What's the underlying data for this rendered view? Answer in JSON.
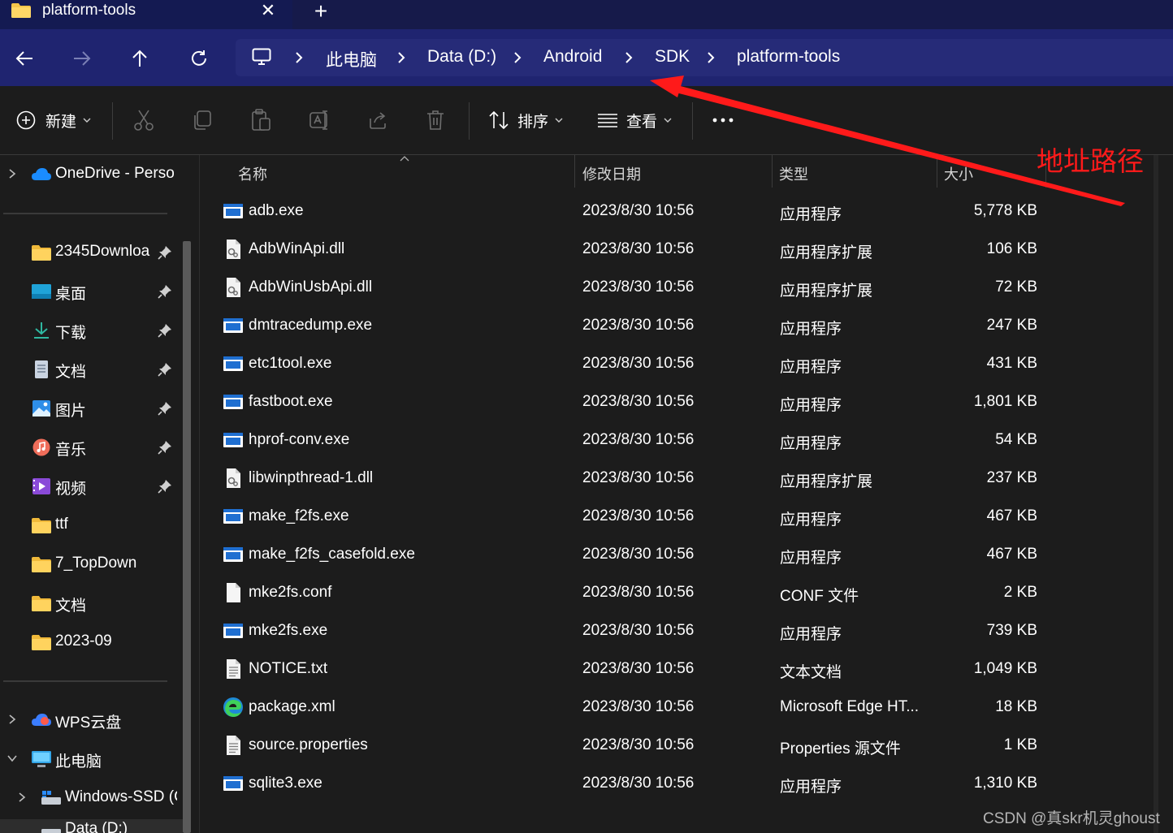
{
  "window": {
    "tab_title": "platform-tools",
    "close_symbol": "✕",
    "new_tab_symbol": "+"
  },
  "nav": {
    "breadcrumbs": [
      "此电脑",
      "Data (D:)",
      "Android",
      "SDK",
      "platform-tools"
    ]
  },
  "toolbar": {
    "new_label": "新建",
    "sort_label": "排序",
    "view_label": "查看"
  },
  "sidebar": {
    "onedrive": "OneDrive - Perso",
    "pinned": [
      {
        "label": "2345Downloa",
        "icon": "folder-icon"
      },
      {
        "label": "桌面",
        "icon": "desktop-icon"
      },
      {
        "label": "下载",
        "icon": "download-icon"
      },
      {
        "label": "文档",
        "icon": "documents-icon"
      },
      {
        "label": "图片",
        "icon": "pictures-icon"
      },
      {
        "label": "音乐",
        "icon": "music-icon"
      },
      {
        "label": "视频",
        "icon": "videos-icon"
      }
    ],
    "folders": [
      "ttf",
      "7_TopDown",
      "文档",
      "2023-09"
    ],
    "wps": "WPS云盘",
    "this_pc": "此电脑",
    "windows_ssd": "Windows-SSD (C",
    "data_drive": "Data (D:)"
  },
  "columns": {
    "name": "名称",
    "date": "修改日期",
    "type": "类型",
    "size": "大小"
  },
  "files": [
    {
      "name": "adb.exe",
      "date": "2023/8/30 10:56",
      "type": "应用程序",
      "size": "5,778 KB",
      "icon": "exe"
    },
    {
      "name": "AdbWinApi.dll",
      "date": "2023/8/30 10:56",
      "type": "应用程序扩展",
      "size": "106 KB",
      "icon": "dll"
    },
    {
      "name": "AdbWinUsbApi.dll",
      "date": "2023/8/30 10:56",
      "type": "应用程序扩展",
      "size": "72 KB",
      "icon": "dll"
    },
    {
      "name": "dmtracedump.exe",
      "date": "2023/8/30 10:56",
      "type": "应用程序",
      "size": "247 KB",
      "icon": "exe"
    },
    {
      "name": "etc1tool.exe",
      "date": "2023/8/30 10:56",
      "type": "应用程序",
      "size": "431 KB",
      "icon": "exe"
    },
    {
      "name": "fastboot.exe",
      "date": "2023/8/30 10:56",
      "type": "应用程序",
      "size": "1,801 KB",
      "icon": "exe"
    },
    {
      "name": "hprof-conv.exe",
      "date": "2023/8/30 10:56",
      "type": "应用程序",
      "size": "54 KB",
      "icon": "exe"
    },
    {
      "name": "libwinpthread-1.dll",
      "date": "2023/8/30 10:56",
      "type": "应用程序扩展",
      "size": "237 KB",
      "icon": "dll"
    },
    {
      "name": "make_f2fs.exe",
      "date": "2023/8/30 10:56",
      "type": "应用程序",
      "size": "467 KB",
      "icon": "exe"
    },
    {
      "name": "make_f2fs_casefold.exe",
      "date": "2023/8/30 10:56",
      "type": "应用程序",
      "size": "467 KB",
      "icon": "exe"
    },
    {
      "name": "mke2fs.conf",
      "date": "2023/8/30 10:56",
      "type": "CONF 文件",
      "size": "2 KB",
      "icon": "blank"
    },
    {
      "name": "mke2fs.exe",
      "date": "2023/8/30 10:56",
      "type": "应用程序",
      "size": "739 KB",
      "icon": "exe"
    },
    {
      "name": "NOTICE.txt",
      "date": "2023/8/30 10:56",
      "type": "文本文档",
      "size": "1,049 KB",
      "icon": "txt"
    },
    {
      "name": "package.xml",
      "date": "2023/8/30 10:56",
      "type": "Microsoft Edge HT...",
      "size": "18 KB",
      "icon": "edge"
    },
    {
      "name": "source.properties",
      "date": "2023/8/30 10:56",
      "type": "Properties 源文件",
      "size": "1 KB",
      "icon": "txt"
    },
    {
      "name": "sqlite3.exe",
      "date": "2023/8/30 10:56",
      "type": "应用程序",
      "size": "1,310 KB",
      "icon": "exe"
    }
  ],
  "annotation": {
    "text": "地址路径",
    "color": "#ff1a1a"
  },
  "watermark": "CSDN @真skr机灵ghoust"
}
